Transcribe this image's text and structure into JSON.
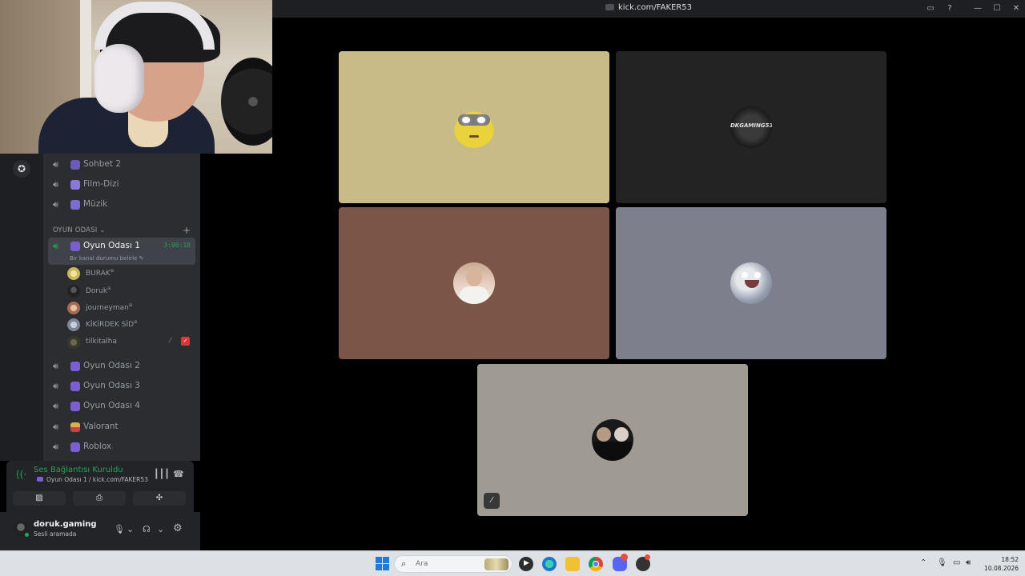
{
  "window": {
    "title": "kick.com/FAKER53",
    "controls": [
      "▭",
      "?",
      "—",
      "☐",
      "✕"
    ]
  },
  "channels": [
    {
      "label": "Sohbet 2"
    },
    {
      "label": "Film-Dizi"
    },
    {
      "label": "Müzik"
    }
  ],
  "category": {
    "label": "OYUN ODASI",
    "chevron": "⌄",
    "plus": "+"
  },
  "active_channel": {
    "label": "Oyun Odası 1",
    "timer": "3:00:18",
    "status_placeholder": "Bir kanal durumu belirle"
  },
  "members": [
    {
      "name": "BURAK",
      "color": "#d9c45a"
    },
    {
      "name": "Doruk",
      "color": "#2a2a2a"
    },
    {
      "name": "journeyman",
      "color": "#b87a5c"
    },
    {
      "name": "KİKİRDEK SİD",
      "color": "#8a96a8"
    },
    {
      "name": "tilkitalha",
      "color": "#4a4a3a"
    }
  ],
  "more_channels": [
    {
      "label": "Oyun Odası 2"
    },
    {
      "label": "Oyun Odası 3"
    },
    {
      "label": "Oyun Odası 4"
    },
    {
      "label": "Valorant"
    },
    {
      "label": "Roblox"
    }
  ],
  "voice_panel": {
    "title": "Ses Bağlantısı Kuruldu",
    "subtitle": "Oyun Odası 1 / kick.com/FAKER53"
  },
  "user": {
    "name": "doruk.gaming",
    "status": "Sesli aramada"
  },
  "tiles": [
    {
      "bg": "#c8bb87",
      "avatar": "minion-icon"
    },
    {
      "bg": "#232323",
      "avatar": "dkgaming-logo"
    },
    {
      "bg": "#7b5646",
      "avatar": "man-avatar"
    },
    {
      "bg": "#7e7f8d",
      "avatar": "sid-avatar"
    },
    {
      "bg": "#9f9b93",
      "avatar": "duo-avatar"
    }
  ],
  "tile_logo_text": "DKGAMING53",
  "taskbar": {
    "search_placeholder": "Ara",
    "time": "18:52",
    "date": "10.08.2026"
  }
}
